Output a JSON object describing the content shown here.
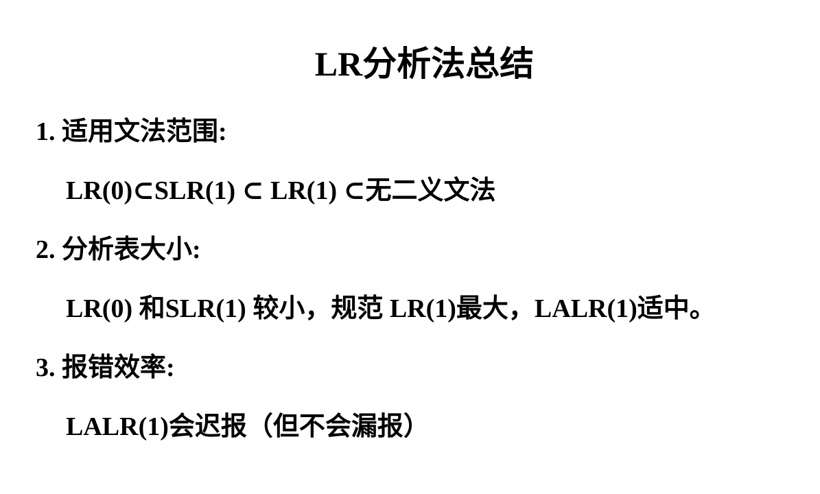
{
  "title": "LR分析法总结",
  "items": [
    {
      "heading": "1. 适用文法范围:",
      "body": "LR(0)⊂SLR(1) ⊂ LR(1) ⊂无二义文法"
    },
    {
      "heading": "2. 分析表大小:",
      "body": "LR(0) 和SLR(1) 较小，规范 LR(1)最大，LALR(1)适中。"
    },
    {
      "heading": "3. 报错效率:",
      "body": "LALR(1)会迟报（但不会漏报）"
    }
  ]
}
